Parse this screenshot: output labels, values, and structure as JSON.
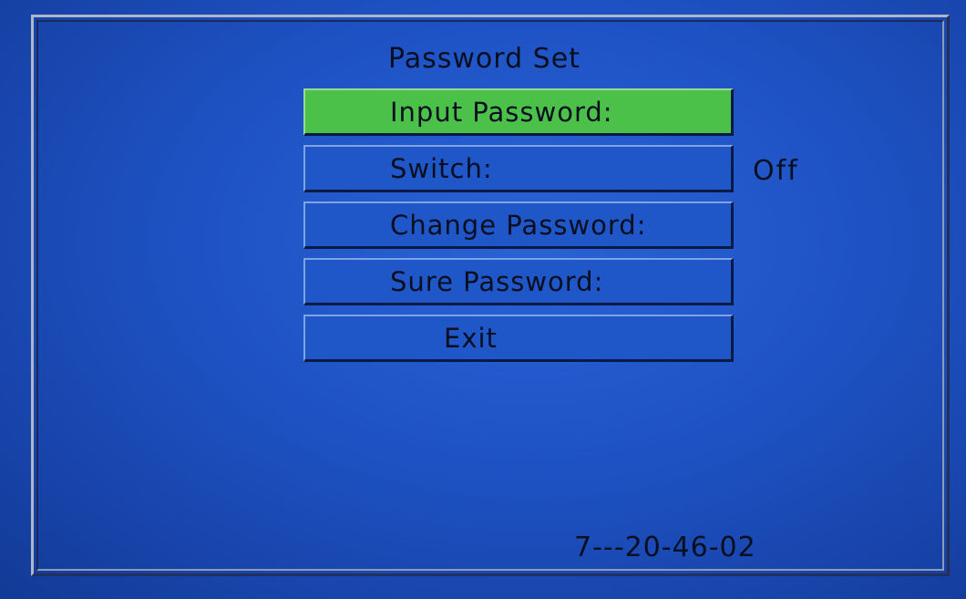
{
  "menu": {
    "title": "Password Set",
    "items": [
      {
        "label": "Input Password:",
        "selected": true
      },
      {
        "label": "Switch:",
        "selected": false
      },
      {
        "label": "Change Password:",
        "selected": false
      },
      {
        "label": "Sure Password:",
        "selected": false
      },
      {
        "label": "Exit",
        "selected": false
      }
    ],
    "switch_value": "Off"
  },
  "status": {
    "clock": "7---20-46-02"
  },
  "colors": {
    "background": "#1e52c4",
    "selected_item": "#4cc14a",
    "text": "#0a0f20"
  }
}
